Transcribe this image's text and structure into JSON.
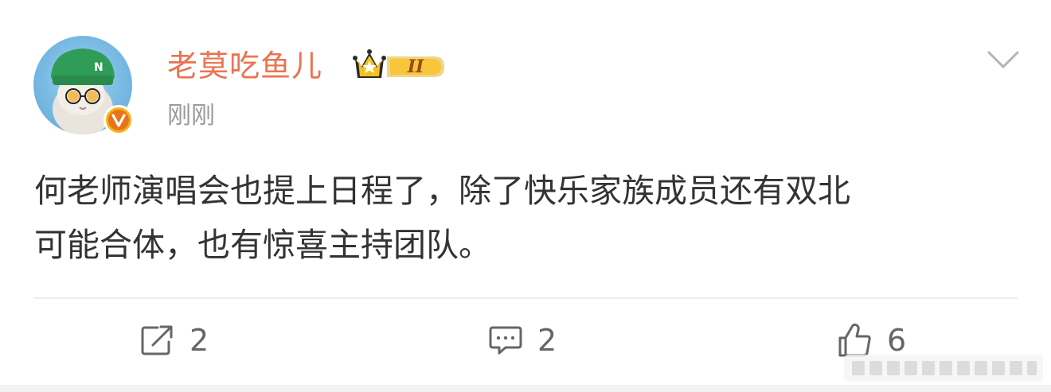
{
  "post": {
    "username": "老莫吃鱼儿",
    "badge_level": "II",
    "timestamp": "刚刚",
    "text_lines": [
      "何老师演唱会也提上日程了，除了快乐家族成员还有双北",
      "可能合体，也有惊喜主持团队。"
    ]
  },
  "actions": {
    "repost_count": "2",
    "comment_count": "2",
    "like_count": "6"
  },
  "colors": {
    "username": "#eb7350",
    "timestamp": "#999999",
    "text": "#333333",
    "verified_badge": "#f6b21a",
    "crown": "#e6a817"
  },
  "icons": {
    "avatar": "cat-with-green-beanie-avatar",
    "verified": "verified-v-icon",
    "crown": "crown-level-badge-icon",
    "more": "chevron-down-icon",
    "repost": "repost-icon",
    "comment": "comment-icon",
    "like": "thumbs-up-icon"
  }
}
